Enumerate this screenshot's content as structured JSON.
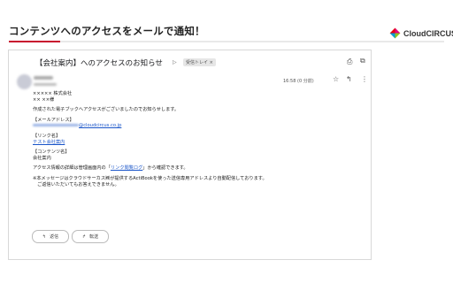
{
  "banner": {
    "title": "コンテンツへのアクセスをメールで通知！",
    "accent_color": "#c8102e"
  },
  "logo": {
    "text": "CloudCIRCUS"
  },
  "email": {
    "subject": "【会社案内】へのアクセスのお知らせ",
    "inbox_label": "受信トレイ ×",
    "time": "16:58 (0 分前)",
    "body": {
      "company": "××××× 株式会社",
      "salutation": "×× ××様",
      "intro": "作成された電子ブックへアクセスがございましたのでお知らせします。",
      "email_heading": "【メールアドレス】",
      "email_domain": "@cloudcircus.co.jp",
      "link_heading": "【リンク名】",
      "link_name": "テスト会社案内",
      "content_heading": "【コンテンツ名】",
      "content_name": "会社案内",
      "detail_prefix": "アクセス情報の詳細は管理画面内の「",
      "detail_link": "リンク閲覧ログ",
      "detail_suffix": "」から確認できます。",
      "note1": "※本メッセージはクラウドサーカス㈱が提供するActiBookを使った送信専用アドレスより自動配信しております。",
      "note2": "ご返信いただいてもお答えできません。"
    },
    "buttons": {
      "reply": "返信",
      "forward": "転送"
    }
  }
}
